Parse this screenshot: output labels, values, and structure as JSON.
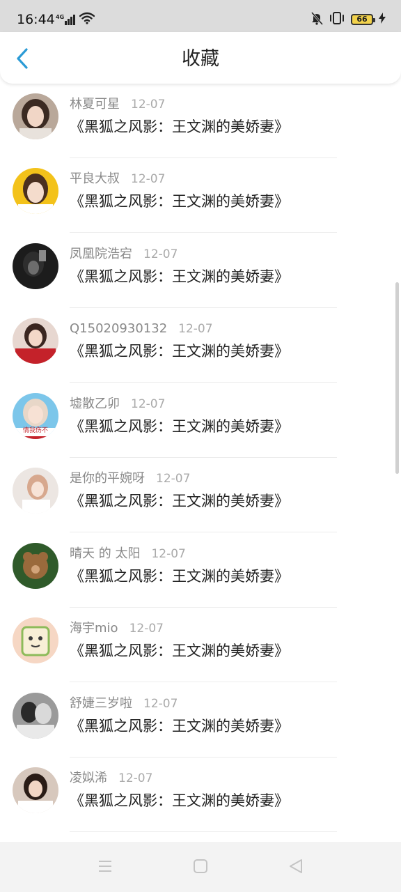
{
  "status_bar": {
    "time": "16:44",
    "network": "4G",
    "battery_level": "66"
  },
  "header": {
    "title": "收藏"
  },
  "items": [
    {
      "name": "林夏可星",
      "date": "12-07",
      "title": "《黑狐之风影：王文渊的美娇妻》"
    },
    {
      "name": "平良大叔",
      "date": "12-07",
      "title": "《黑狐之风影：王文渊的美娇妻》"
    },
    {
      "name": "凤凰院浩宕",
      "date": "12-07",
      "title": "《黑狐之风影：王文渊的美娇妻》"
    },
    {
      "name": "Q15020930132",
      "date": "12-07",
      "title": "《黑狐之风影：王文渊的美娇妻》"
    },
    {
      "name": "墟散乙卯",
      "date": "12-07",
      "title": "《黑狐之风影：王文渊的美娇妻》"
    },
    {
      "name": "是你的平婉呀",
      "date": "12-07",
      "title": "《黑狐之风影：王文渊的美娇妻》"
    },
    {
      "name": "晴天 的 太阳",
      "date": "12-07",
      "title": "《黑狐之风影：王文渊的美娇妻》"
    },
    {
      "name": "海宇mio",
      "date": "12-07",
      "title": "《黑狐之风影：王文渊的美娇妻》"
    },
    {
      "name": "舒婕三岁啦",
      "date": "12-07",
      "title": "《黑狐之风影：王文渊的美娇妻》"
    },
    {
      "name": "凌姒浠",
      "date": "12-07",
      "title": "《黑狐之风影：王文渊的美娇妻》"
    }
  ],
  "avatar_text": "情我伤不",
  "colors": {
    "accent": "#2b9bd6",
    "status_bar_bg": "#dcdcdc",
    "battery_fill": "#f2d24b",
    "nav_bar_bg": "#f3f3f3"
  },
  "icons": {
    "back": "chevron-left-icon",
    "nav_menu": "menu-icon",
    "nav_home": "home-square-icon",
    "nav_back": "back-triangle-icon"
  }
}
